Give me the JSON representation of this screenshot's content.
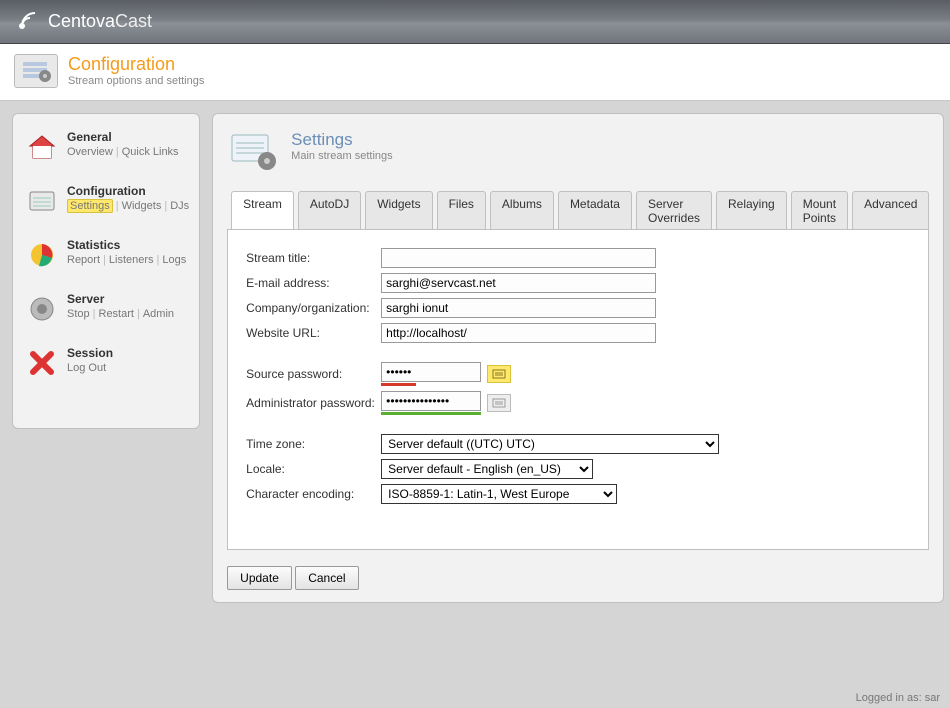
{
  "brand": {
    "first": "Centova",
    "second": "Cast"
  },
  "page_header": {
    "title": "Configuration",
    "subtitle": "Stream options and settings"
  },
  "sidebar": {
    "items": [
      {
        "title": "General",
        "links": [
          "Overview",
          "Quick Links"
        ]
      },
      {
        "title": "Configuration",
        "links": [
          "Settings",
          "Widgets",
          "DJs"
        ]
      },
      {
        "title": "Statistics",
        "links": [
          "Report",
          "Listeners",
          "Logs"
        ]
      },
      {
        "title": "Server",
        "links": [
          "Stop",
          "Restart",
          "Admin"
        ]
      },
      {
        "title": "Session",
        "links": [
          "Log Out"
        ]
      }
    ]
  },
  "panel": {
    "title": "Settings",
    "subtitle": "Main stream settings"
  },
  "tabs": [
    "Stream",
    "AutoDJ",
    "Widgets",
    "Files",
    "Albums",
    "Metadata",
    "Server Overrides",
    "Relaying",
    "Mount Points",
    "Advanced"
  ],
  "active_tab": "Stream",
  "form": {
    "labels": {
      "stream_title": "Stream title:",
      "email": "E-mail address:",
      "company": "Company/organization:",
      "website": "Website URL:",
      "source_pw": "Source password:",
      "admin_pw": "Administrator password:",
      "timezone": "Time zone:",
      "locale": "Locale:",
      "encoding": "Character encoding:"
    },
    "values": {
      "stream_title": "",
      "email": "sarghi@servcast.net",
      "company": "sarghi ionut",
      "website": "http://localhost/",
      "source_pw": "••••••",
      "admin_pw": "•••••••••••••••",
      "timezone": "Server default ((UTC) UTC)",
      "locale": "Server default - English (en_US)",
      "encoding": "ISO-8859-1: Latin-1, West Europe"
    }
  },
  "buttons": {
    "update": "Update",
    "cancel": "Cancel"
  },
  "footer": "Logged in as: sar"
}
